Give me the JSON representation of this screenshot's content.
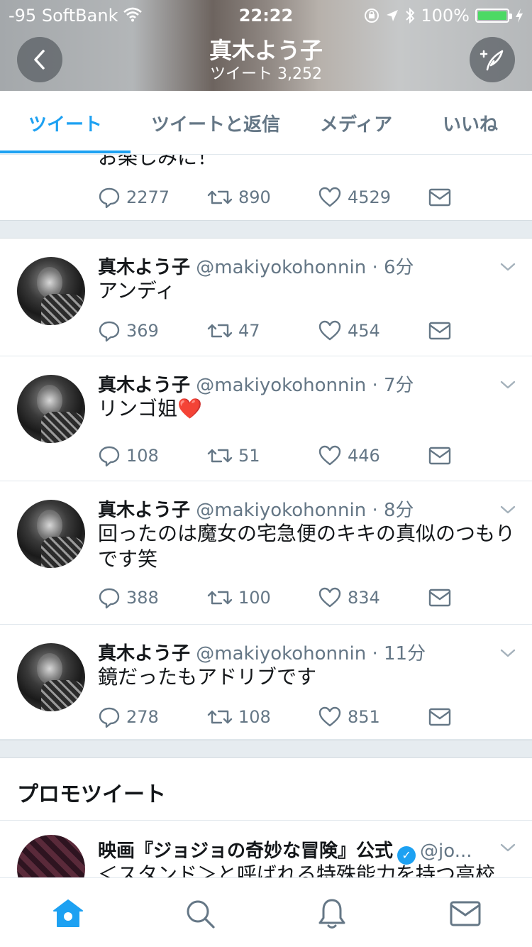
{
  "status_bar": {
    "carrier": "-95 SoftBank",
    "time": "22:22",
    "battery": "100%",
    "battery_level": 1.0
  },
  "header": {
    "title": "真木よう子",
    "subtitle": "ツイート 3,252",
    "back_icon": "chevron-left-icon",
    "compose_icon": "compose-feather-icon"
  },
  "tabs": [
    {
      "label": "ツイート",
      "active": true
    },
    {
      "label": "ツイートと返信",
      "active": false
    },
    {
      "label": "メディア",
      "active": false
    },
    {
      "label": "いいね",
      "active": false
    }
  ],
  "partial_tweet": {
    "text": "お楽しみに！",
    "replies": "2277",
    "retweets": "890",
    "likes": "4529"
  },
  "tweets": [
    {
      "name": "真木よう子",
      "handle": "@makiyokohonnin",
      "time": "6分",
      "text": "アンディ",
      "replies": "369",
      "retweets": "47",
      "likes": "454"
    },
    {
      "name": "真木よう子",
      "handle": "@makiyokohonnin",
      "time": "7分",
      "text": "リンゴ姐❤️",
      "replies": "108",
      "retweets": "51",
      "likes": "446"
    },
    {
      "name": "真木よう子",
      "handle": "@makiyokohonnin",
      "time": "8分",
      "text": "回ったのは魔女の宅急便のキキの真似のつもりです笑",
      "replies": "388",
      "retweets": "100",
      "likes": "834"
    },
    {
      "name": "真木よう子",
      "handle": "@makiyokohonnin",
      "time": "11分",
      "text": "鏡だったもアドリブです",
      "replies": "278",
      "retweets": "108",
      "likes": "851"
    }
  ],
  "promoted": {
    "section_title": "プロモツイート",
    "name": "映画『ジョジョの奇妙な冒険』公式",
    "handle": "@jo...",
    "avatar_label": "jojomovie_jp",
    "text": "＜スタンド＞と呼ばれる特殊能力を持つ高校"
  },
  "bottom_nav": [
    "home-icon",
    "search-icon",
    "notifications-bell-icon",
    "messages-envelope-icon"
  ],
  "colors": {
    "accent": "#1da1f2",
    "muted": "#657786",
    "separator": "#e6ecf0"
  }
}
